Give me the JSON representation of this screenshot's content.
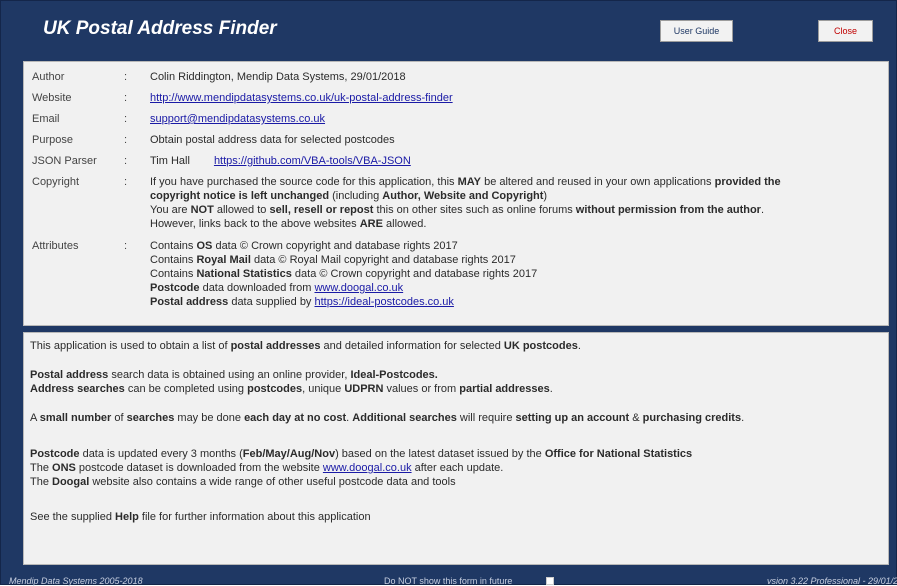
{
  "header": {
    "title": "UK Postal Address Finder",
    "user_guide_label": "User Guide",
    "close_label": "Close"
  },
  "info": {
    "author": {
      "label": "Author",
      "sep": ":",
      "value": "Colin Riddington, Mendip Data Systems, 29/01/2018"
    },
    "website": {
      "label": "Website",
      "sep": ":",
      "value": "http://www.mendipdatasystems.co.uk/uk-postal-address-finder"
    },
    "email": {
      "label": "Email",
      "sep": ":",
      "value": "support@mendipdatasystems.co.uk"
    },
    "purpose": {
      "label": "Purpose",
      "sep": ":",
      "value": "Obtain postal address data for selected postcodes"
    },
    "json_parser": {
      "label": "JSON Parser",
      "sep": ":",
      "name": "Tim Hall",
      "link": "https://github.com/VBA-tools/VBA-JSON"
    },
    "copyright": {
      "label": "Copyright",
      "sep": ":",
      "l1a": "If you have purchased the source code for this application, this ",
      "l1b": "MAY",
      "l1c": " be altered and reused in your own applications ",
      "l1d": "provided the",
      "l2a": "copyright notice is left unchanged",
      "l2b": "  (including ",
      "l2c": "Author, Website and Copyright",
      "l2d": ")",
      "l3a": "You are ",
      "l3b": "NOT",
      "l3c": " allowed to ",
      "l3d": "sell, resell or repost",
      "l3e": " this on other sites such as online forums ",
      "l3f": "without permission from the author",
      "l3g": ".",
      "l4a": "However, links back to the above websites ",
      "l4b": "ARE",
      "l4c": " allowed."
    },
    "attributes": {
      "label": "Attributes",
      "sep": ":",
      "a1a": "Contains ",
      "a1b": "OS",
      "a1c": " data © Crown copyright and database rights 2017",
      "a2a": "Contains ",
      "a2b": "Royal Mail",
      "a2c": " data © Royal Mail copyright and database rights 2017",
      "a3a": "Contains ",
      "a3b": "National Statistics",
      "a3c": " data © Crown copyright and database rights 2017",
      "a4a": "Postcode",
      "a4b": " data downloaded from ",
      "a4c": "www.doogal.co.uk",
      "a5a": "Postal address",
      "a5b": " data supplied by ",
      "a5c": "https://ideal-postcodes.co.uk"
    }
  },
  "description": {
    "d1a": "This application is used to obtain a list of ",
    "d1b": "postal addresses",
    "d1c": " and detailed information for selected ",
    "d1d": "UK postcodes",
    "d1e": ".",
    "d2a": "Postal address",
    "d2b": " search data is obtained using an online provider, ",
    "d2c": "Ideal-Postcodes.",
    "d3a": "Address searches",
    "d3b": " can be completed using ",
    "d3c": "postcodes",
    "d3d": ", unique ",
    "d3e": "UDPRN",
    "d3f": " values or from ",
    "d3g": "partial addresses",
    "d3h": ".",
    "d4a": "A ",
    "d4b": "small number",
    "d4c": " of ",
    "d4d": "searches",
    "d4e": " may be done ",
    "d4f": "each day at no cost",
    "d4g": ". ",
    "d4h": "Additional searches",
    "d4i": " will require ",
    "d4j": "setting up an account",
    "d4k": " & ",
    "d4l": "purchasing credits",
    "d4m": ".",
    "d5a": "Postcode",
    "d5b": " data is updated every 3 months (",
    "d5c": "Feb/May/Aug/Nov",
    "d5d": ") based on the latest dataset issued by the ",
    "d5e": "Office for National Statistics",
    "d6a": "The ",
    "d6b": "ONS",
    "d6c": " postcode dataset is downloaded from the website ",
    "d6d": "www.doogal.co.uk",
    "d6e": " after each update.",
    "d7a": "The ",
    "d7b": "Doogal",
    "d7c": " website also contains a wide range of other useful postcode data and tools",
    "d8a": "See the supplied ",
    "d8b": "Help",
    "d8c": " file for further information about this application"
  },
  "footer": {
    "left": "Mendip Data Systems 2005-2018",
    "mid": "Do NOT show this form in future",
    "right": "vsion 3.22 Professional - 29/01/2018"
  }
}
